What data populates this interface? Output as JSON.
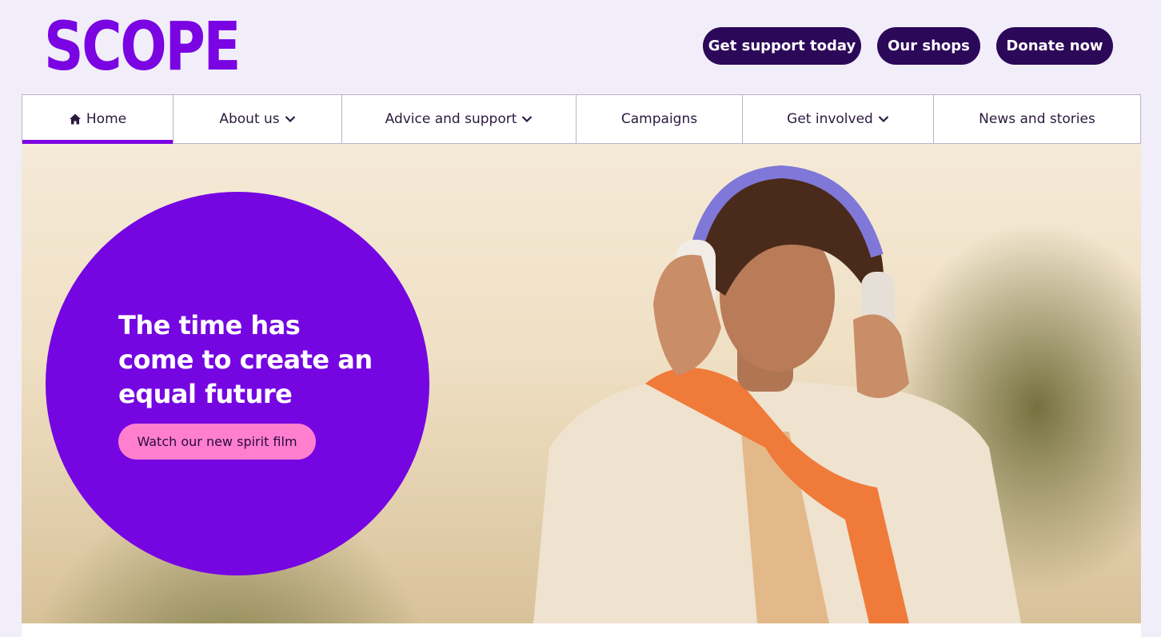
{
  "header": {
    "logo_text": "SCOPE",
    "buttons": [
      {
        "label": "Get support today"
      },
      {
        "label": "Our shops"
      },
      {
        "label": "Donate now"
      }
    ]
  },
  "nav": {
    "items": [
      {
        "label": "Home",
        "icon": "home-icon",
        "active": true
      },
      {
        "label": "About us",
        "dropdown": true
      },
      {
        "label": "Advice and support",
        "dropdown": true
      },
      {
        "label": "Campaigns"
      },
      {
        "label": "Get involved",
        "dropdown": true
      },
      {
        "label": "News and stories"
      }
    ]
  },
  "hero": {
    "headline": "The time has come to create an equal future",
    "cta_label": "Watch our new spirit film"
  },
  "colors": {
    "brand_purple": "#7a04e2",
    "dark_purple": "#2c0859",
    "pink": "#ff7fce",
    "page_bg": "#f1eefa"
  }
}
